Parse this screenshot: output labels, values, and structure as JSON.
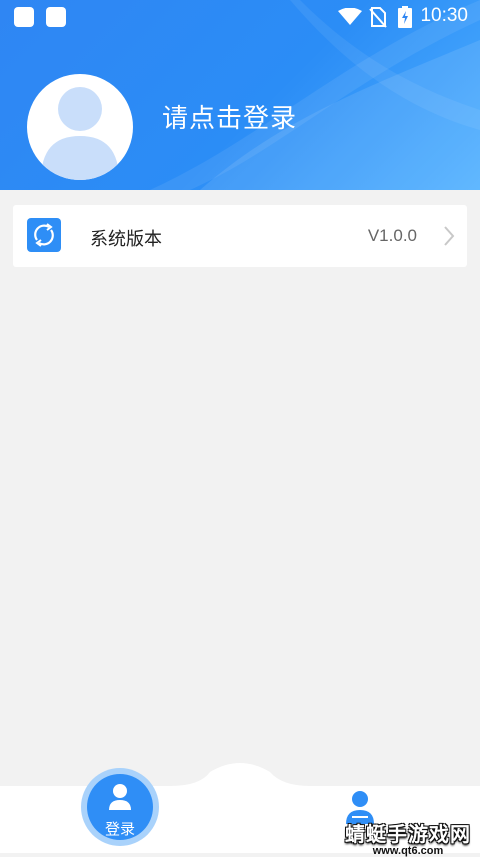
{
  "status_bar": {
    "time": "10:30"
  },
  "profile": {
    "login_prompt": "请点击登录"
  },
  "settings_list": [
    {
      "icon": "refresh-icon",
      "label": "系统版本",
      "value": "V1.0.0"
    }
  ],
  "tab_bar": {
    "login_tab_label": "登录"
  },
  "watermark": {
    "main": "蜻蜓手游戏网",
    "sub": "www.qt6.com"
  },
  "colors": {
    "primary": "#2f8ef6",
    "background": "#f2f2f2"
  }
}
